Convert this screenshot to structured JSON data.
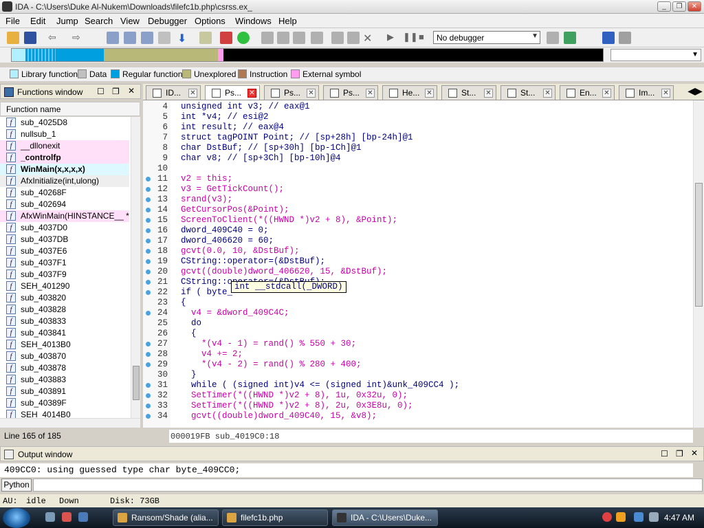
{
  "window": {
    "title": "IDA - C:\\Users\\Duke Al-Nukem\\Downloads\\filefc1b.php\\csrss.ex_"
  },
  "menu": [
    "File",
    "Edit",
    "Jump",
    "Search",
    "View",
    "Debugger",
    "Options",
    "Windows",
    "Help"
  ],
  "toolbar": {
    "debugger_select": "No debugger"
  },
  "legend": [
    {
      "label": "Library function",
      "color": "#b0f0ff"
    },
    {
      "label": "Data",
      "color": "#c0c0c0"
    },
    {
      "label": "Regular function",
      "color": "#00a0e0"
    },
    {
      "label": "Unexplored",
      "color": "#b8b878"
    },
    {
      "label": "Instruction",
      "color": "#b07850"
    },
    {
      "label": "External symbol",
      "color": "#ff9cf0"
    }
  ],
  "functions_window": {
    "title": "Functions window",
    "column_header": "Function name",
    "items": [
      {
        "name": "sub_4025D8",
        "style": "normal"
      },
      {
        "name": "nullsub_1",
        "style": "normal"
      },
      {
        "name": "__dllonexit",
        "style": "pink"
      },
      {
        "name": "_controlfp",
        "style": "pinkbold"
      },
      {
        "name": "WinMain(x,x,x,x)",
        "style": "cyanbold"
      },
      {
        "name": "AfxInitialize(int,ulong)",
        "style": "gray"
      },
      {
        "name": "sub_40268F",
        "style": "normal"
      },
      {
        "name": "sub_402694",
        "style": "normal"
      },
      {
        "name": "AfxWinMain(HINSTANCE__ *,HI",
        "style": "pink"
      },
      {
        "name": "sub_4037D0",
        "style": "normal"
      },
      {
        "name": "sub_4037DB",
        "style": "normal"
      },
      {
        "name": "sub_4037E6",
        "style": "normal"
      },
      {
        "name": "sub_4037F1",
        "style": "normal"
      },
      {
        "name": "sub_4037F9",
        "style": "normal"
      },
      {
        "name": "SEH_401290",
        "style": "normal"
      },
      {
        "name": "sub_403820",
        "style": "normal"
      },
      {
        "name": "sub_403828",
        "style": "normal"
      },
      {
        "name": "sub_403833",
        "style": "normal"
      },
      {
        "name": "sub_403841",
        "style": "normal"
      },
      {
        "name": "SEH_4013B0",
        "style": "normal"
      },
      {
        "name": "sub_403870",
        "style": "normal"
      },
      {
        "name": "sub_403878",
        "style": "normal"
      },
      {
        "name": "sub_403883",
        "style": "normal"
      },
      {
        "name": "sub_403891",
        "style": "normal"
      },
      {
        "name": "sub_40389F",
        "style": "normal"
      },
      {
        "name": "SEH_4014B0",
        "style": "normal"
      }
    ],
    "line_info": "Line 165 of 185"
  },
  "tabs": [
    {
      "label": "ID...",
      "active": false
    },
    {
      "label": "Ps...",
      "active": true
    },
    {
      "label": "Ps...",
      "active": false
    },
    {
      "label": "Ps...",
      "active": false
    },
    {
      "label": "He...",
      "active": false
    },
    {
      "label": "St...",
      "active": false
    },
    {
      "label": "St...",
      "active": false
    },
    {
      "label": "En...",
      "active": false
    },
    {
      "label": "Im...",
      "active": false
    }
  ],
  "code_lines": [
    {
      "n": "4",
      "dot": false,
      "text": "unsigned int v3; // eax@1"
    },
    {
      "n": "5",
      "dot": false,
      "text": "int *v4; // esi@2"
    },
    {
      "n": "6",
      "dot": false,
      "text": "int result; // eax@4"
    },
    {
      "n": "7",
      "dot": false,
      "text": "struct tagPOINT Point; // [sp+28h] [bp-24h]@1"
    },
    {
      "n": "8",
      "dot": false,
      "text": "char DstBuf; // [sp+30h] [bp-1Ch]@1"
    },
    {
      "n": "9",
      "dot": false,
      "text": "char v8; // [sp+3Ch] [bp-10h]@4"
    },
    {
      "n": "10",
      "dot": false,
      "text": ""
    },
    {
      "n": "11",
      "dot": true,
      "text": "v2 = this;"
    },
    {
      "n": "12",
      "dot": true,
      "text": "v3 = GetTickCount();"
    },
    {
      "n": "13",
      "dot": true,
      "text": "srand(v3);"
    },
    {
      "n": "14",
      "dot": true,
      "text": "GetCursorPos(&Point);"
    },
    {
      "n": "15",
      "dot": true,
      "text": "ScreenToClient(*((HWND *)v2 + 8), &Point);"
    },
    {
      "n": "16",
      "dot": true,
      "text": "dword_409C40 = 0;"
    },
    {
      "n": "17",
      "dot": true,
      "text": "dword_406620 = 60;"
    },
    {
      "n": "18",
      "dot": true,
      "text": "gcvt(0.0, 10, &DstBuf);"
    },
    {
      "n": "19",
      "dot": true,
      "text": "CString::operator=(&DstBuf);"
    },
    {
      "n": "20",
      "dot": true,
      "text": "gcvt((double)dword_406620, 15, &DstBuf);"
    },
    {
      "n": "21",
      "dot": true,
      "text": "CString::operator=(&DstBuf);"
    },
    {
      "n": "22",
      "dot": true,
      "text": "if ( byte_"
    },
    {
      "n": "23",
      "dot": false,
      "text": "{"
    },
    {
      "n": "24",
      "dot": true,
      "text": "  v4 = &dword_409C4C;"
    },
    {
      "n": "25",
      "dot": false,
      "text": "  do"
    },
    {
      "n": "26",
      "dot": false,
      "text": "  {"
    },
    {
      "n": "27",
      "dot": true,
      "text": "    *(v4 - 1) = rand() % 550 + 30;"
    },
    {
      "n": "28",
      "dot": true,
      "text": "    v4 += 2;"
    },
    {
      "n": "29",
      "dot": true,
      "text": "    *(v4 - 2) = rand() % 280 + 400;"
    },
    {
      "n": "30",
      "dot": false,
      "text": "  }"
    },
    {
      "n": "31",
      "dot": true,
      "text": "  while ( (signed int)v4 <= (signed int)&unk_409CC4 );"
    },
    {
      "n": "32",
      "dot": true,
      "text": "  SetTimer(*((HWND *)v2 + 8), 1u, 0x32u, 0);"
    },
    {
      "n": "33",
      "dot": true,
      "text": "  SetTimer(*((HWND *)v2 + 8), 2u, 0x3E8u, 0);"
    },
    {
      "n": "34",
      "dot": true,
      "text": "  gcvt((double)dword_409C40, 15, &v8);"
    }
  ],
  "tooltip": "int __stdcall(_DWORD)",
  "code_status": "000019FB sub_4019C0:18",
  "output_window": {
    "title": "Output window",
    "text": "409CC0: using guessed type char byte_409CC0;"
  },
  "python_button": "Python",
  "status": {
    "au": "AU:",
    "state": "idle",
    "direction": "Down",
    "disk": "Disk: 73GB"
  },
  "taskbar": {
    "items": [
      {
        "label": "Ransom/Shade (alia...",
        "active": false
      },
      {
        "label": "filefc1b.php",
        "active": false
      },
      {
        "label": "IDA - C:\\Users\\Duke...",
        "active": true
      }
    ],
    "clock": "4:47 AM"
  }
}
